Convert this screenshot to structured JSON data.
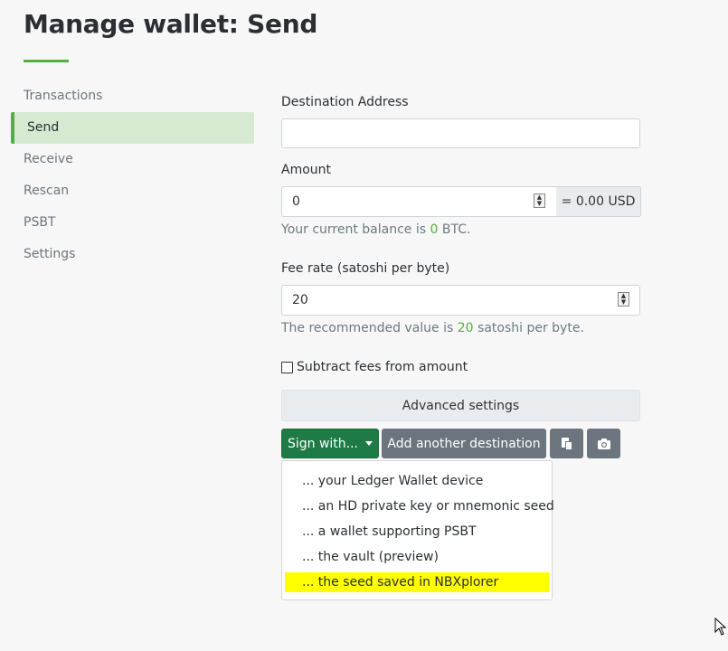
{
  "page": {
    "title": "Manage wallet: Send",
    "accent_color": "#51b13e"
  },
  "sidebar": {
    "items": [
      {
        "label": "Transactions",
        "active": false
      },
      {
        "label": "Send",
        "active": true
      },
      {
        "label": "Receive",
        "active": false
      },
      {
        "label": "Rescan",
        "active": false
      },
      {
        "label": "PSBT",
        "active": false
      },
      {
        "label": "Settings",
        "active": false
      }
    ]
  },
  "form": {
    "destination": {
      "label": "Destination Address",
      "value": "",
      "placeholder": ""
    },
    "amount": {
      "label": "Amount",
      "value": "0",
      "usd": "= 0.00 USD"
    },
    "balance_help": {
      "prefix": "Your current balance is ",
      "value": "0",
      "suffix": " BTC."
    },
    "fee": {
      "label": "Fee rate (satoshi per byte)",
      "value": "20"
    },
    "fee_help": {
      "prefix": "The recommended value is ",
      "value": "20",
      "suffix": " satoshi per byte."
    },
    "subtract_fees": {
      "label": "Subtract fees from amount",
      "checked": false
    },
    "advanced_label": "Advanced settings"
  },
  "buttons": {
    "sign_with": "Sign with...",
    "add_destination": "Add another destination",
    "paste_icon": "clipboard-icon",
    "camera_icon": "camera-icon"
  },
  "sign_menu": {
    "items": [
      {
        "label": "... your Ledger Wallet device",
        "highlighted": false
      },
      {
        "label": "... an HD private key or mnemonic seed",
        "highlighted": false
      },
      {
        "label": "... a wallet supporting PSBT",
        "highlighted": false
      },
      {
        "label": "... the vault (preview)",
        "highlighted": false
      },
      {
        "label": "... the seed saved in NBXplorer",
        "highlighted": true
      }
    ]
  }
}
